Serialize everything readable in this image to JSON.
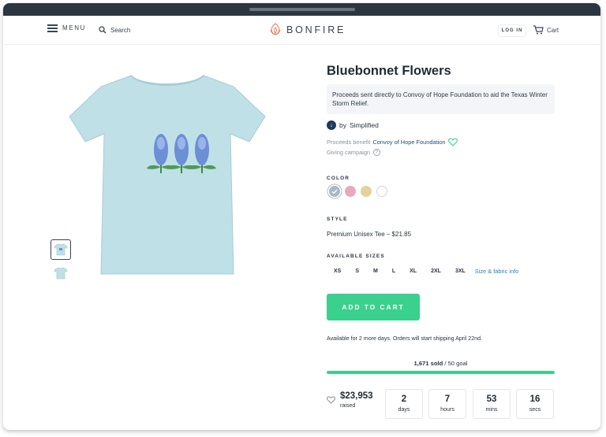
{
  "header": {
    "menu_label": "MENU",
    "search_placeholder": "Search",
    "brand": "BONFIRE",
    "login_label": "LOG IN",
    "cart_label": "Cart"
  },
  "product": {
    "title": "Bluebonnet Flowers",
    "cause_text": "Proceeds sent directly to Convoy of Hope Foundation to aid the Texas Winter Storm Relief.",
    "creator_prefix": "by",
    "creator": "Simplified",
    "benefit_prefix": "Proceeds benefit",
    "benefit_org": "Convoy of Hope Foundation",
    "campaign_type": "Giving campaign",
    "color_label": "COLOR",
    "colors": [
      {
        "name": "heather-ice-blue",
        "hex": "#a9bac7",
        "selected": true
      },
      {
        "name": "pink",
        "hex": "#e8a9bb",
        "selected": false
      },
      {
        "name": "yellow",
        "hex": "#e3d29a",
        "selected": false
      },
      {
        "name": "white",
        "hex": "#ffffff",
        "selected": false
      }
    ],
    "style_label": "STYLE",
    "style_value": "Premium Unisex Tee – $21.85",
    "sizes_label": "AVAILABLE SIZES",
    "sizes": [
      "XS",
      "S",
      "M",
      "L",
      "XL",
      "2XL",
      "3XL"
    ],
    "size_link": "Size & fabric info",
    "add_to_cart": "ADD TO CART",
    "availability": "Available for 2 more days. Orders will start shipping April 22nd.",
    "sold_count": "1,671 sold",
    "sold_goal": " / 50 goal",
    "progress_fraction": 1.0,
    "raised_amount": "$23,953",
    "raised_label": "raised",
    "countdown": [
      {
        "num": "2",
        "unit": "days"
      },
      {
        "num": "7",
        "unit": "hours"
      },
      {
        "num": "53",
        "unit": "mins"
      },
      {
        "num": "16",
        "unit": "secs"
      }
    ]
  },
  "colors": {
    "accent": "#3ad08d",
    "brand_logo": "#e98a6b",
    "shirt": "#bfe0e6"
  }
}
